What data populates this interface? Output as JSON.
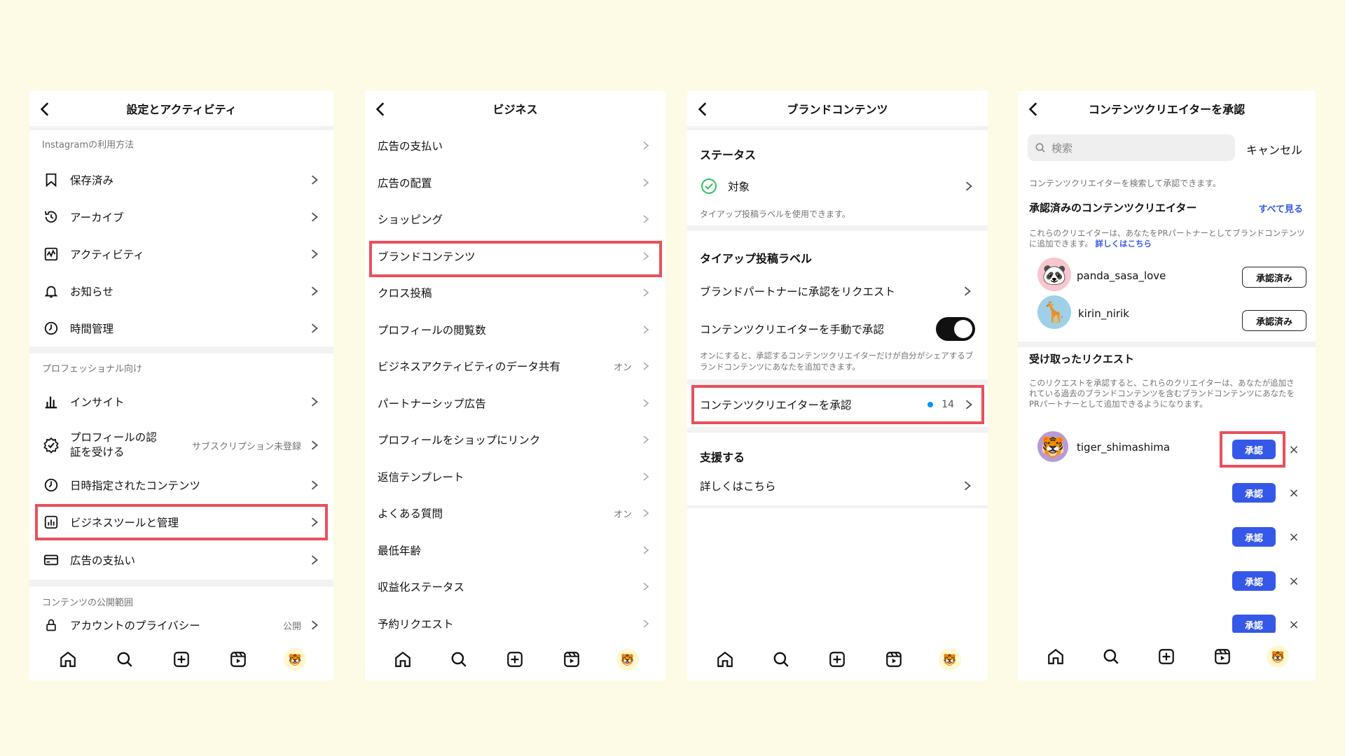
{
  "p1": {
    "title": "設定とアクティビティ",
    "sec1": "Instagramの利用方法",
    "sec1_items": [
      "保存済み",
      "アーカイブ",
      "アクティビティ",
      "お知らせ",
      "時間管理"
    ],
    "sec2": "プロフェッショナル向け",
    "insight": "インサイト",
    "verify_line1": "プロフィールの認",
    "verify_line2": "証を受ける",
    "verify_meta": "サブスクリプション未登録",
    "scheduled": "日時指定されたコンテンツ",
    "business_tools": "ビジネスツールと管理",
    "ad_payment": "広告の支払い",
    "sec3": "コンテンツの公開範囲",
    "privacy": "アカウントのプライバシー",
    "privacy_meta": "公開"
  },
  "p2": {
    "title": "ビジネス",
    "items": [
      {
        "label": "広告の支払い",
        "meta": ""
      },
      {
        "label": "広告の配置",
        "meta": ""
      },
      {
        "label": "ショッピング",
        "meta": ""
      },
      {
        "label": "ブランドコンテンツ",
        "meta": ""
      },
      {
        "label": "クロス投稿",
        "meta": ""
      },
      {
        "label": "プロフィールの閲覧数",
        "meta": ""
      },
      {
        "label": "ビジネスアクティビティのデータ共有",
        "meta": "オン"
      },
      {
        "label": "パートナーシップ広告",
        "meta": ""
      },
      {
        "label": "プロフィールをショップにリンク",
        "meta": ""
      },
      {
        "label": "返信テンプレート",
        "meta": ""
      },
      {
        "label": "よくある質問",
        "meta": "オン"
      },
      {
        "label": "最低年齢",
        "meta": ""
      },
      {
        "label": "収益化ステータス",
        "meta": ""
      },
      {
        "label": "予約リクエスト",
        "meta": ""
      }
    ]
  },
  "p3": {
    "title": "ブランドコンテンツ",
    "status_heading": "ステータス",
    "status_value": "対象",
    "status_desc": "タイアップ投稿ラベルを使用できます。",
    "label_heading": "タイアップ投稿ラベル",
    "request_approval": "ブランドパートナーに承認をリクエスト",
    "manual_approve": "コンテンツクリエイターを手動で承認",
    "manual_desc": "オンにすると、承認するコンテンツクリエイターだけが自分がシェアするブランドコンテンツにあなたを追加できます。",
    "approve_creators": "コンテンツクリエイターを承認",
    "approve_count": "14",
    "support_heading": "支援する",
    "learn_more": "詳しくはこちら"
  },
  "p4": {
    "title": "コンテンツクリエイターを承認",
    "search_placeholder": "検索",
    "cancel": "キャンセル",
    "search_hint": "コンテンツクリエイターを検索して承認できます。",
    "approved_heading": "承認済みのコンテンツクリエイター",
    "see_all": "すべて見る",
    "approved_desc": "これらのクリエイターは、あなたをPRパートナーとしてブランドコンテンツに追加できます。",
    "approved_link": "詳しくはこちら",
    "approved_users": [
      {
        "name": "panda_sasa_love",
        "status": "承認済み"
      },
      {
        "name": "kirin_nirik",
        "status": "承認済み"
      }
    ],
    "requests_heading": "受け取ったリクエスト",
    "requests_desc": "このリクエストを承認すると、これらのクリエイターは、あなたが追加されている過去のブランドコンテンツを含むブランドコンテンツにあなたをPRパートナーとして追加できるようになります。",
    "request_user": "tiger_shimashima",
    "approve_label": "承認"
  },
  "colors": {
    "highlight": "#e8505b",
    "accent": "#3558e8",
    "link": "#3558e8",
    "bg": "#fdfbe6"
  }
}
